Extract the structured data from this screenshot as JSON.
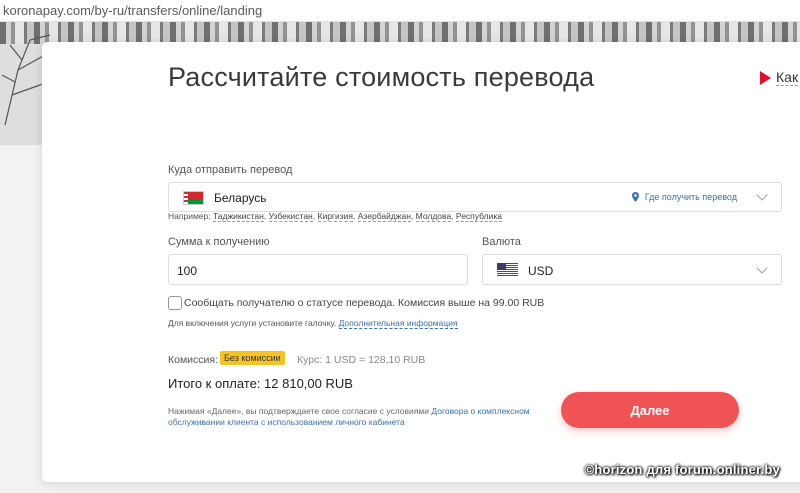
{
  "browser": {
    "url": "koronapay.com/by-ru/transfers/online/landing"
  },
  "calculator": {
    "title": "Рассчитайте стоимость перевода",
    "how_link": "Как",
    "country": {
      "label": "Куда отправить перевод",
      "value": "Беларусь",
      "where_get_link": "Где получить перевод",
      "examples_prefix": "Например:",
      "examples": [
        "Таджикистан",
        "Узбекистан",
        "Киргизия",
        "Азербайджан",
        "Молдова",
        "Республика"
      ]
    },
    "amount": {
      "label": "Сумма к получению",
      "value": "100"
    },
    "currency": {
      "label": "Валюта",
      "value": "USD"
    },
    "notify": {
      "checked": false,
      "text": "Сообщать получателю о статусе перевода. Комиссия выше на 99.00 RUB",
      "hint": "Для включения услуги установите галочку.",
      "hint_link": "Дополнительная информация"
    },
    "fee": {
      "label": "Комиссия:",
      "badge": "Без комиссии",
      "rate": "Курс: 1 USD = 128,10 RUB"
    },
    "total": "Итого к оплате: 12 810,00 RUB",
    "consent": {
      "text": "Нажимая «Далее», вы подтверждаете свое согласие с условиями",
      "link": "Договора о комплексном обслуживании клиента с использованием личного кабинета"
    },
    "next_button": "Далее"
  },
  "watermark": "©horizon для forum.onliner.by",
  "colors": {
    "accent": "#f05356",
    "badge": "#f5c325",
    "link": "#3a6fb0",
    "play_icon": "#e30f2c"
  }
}
